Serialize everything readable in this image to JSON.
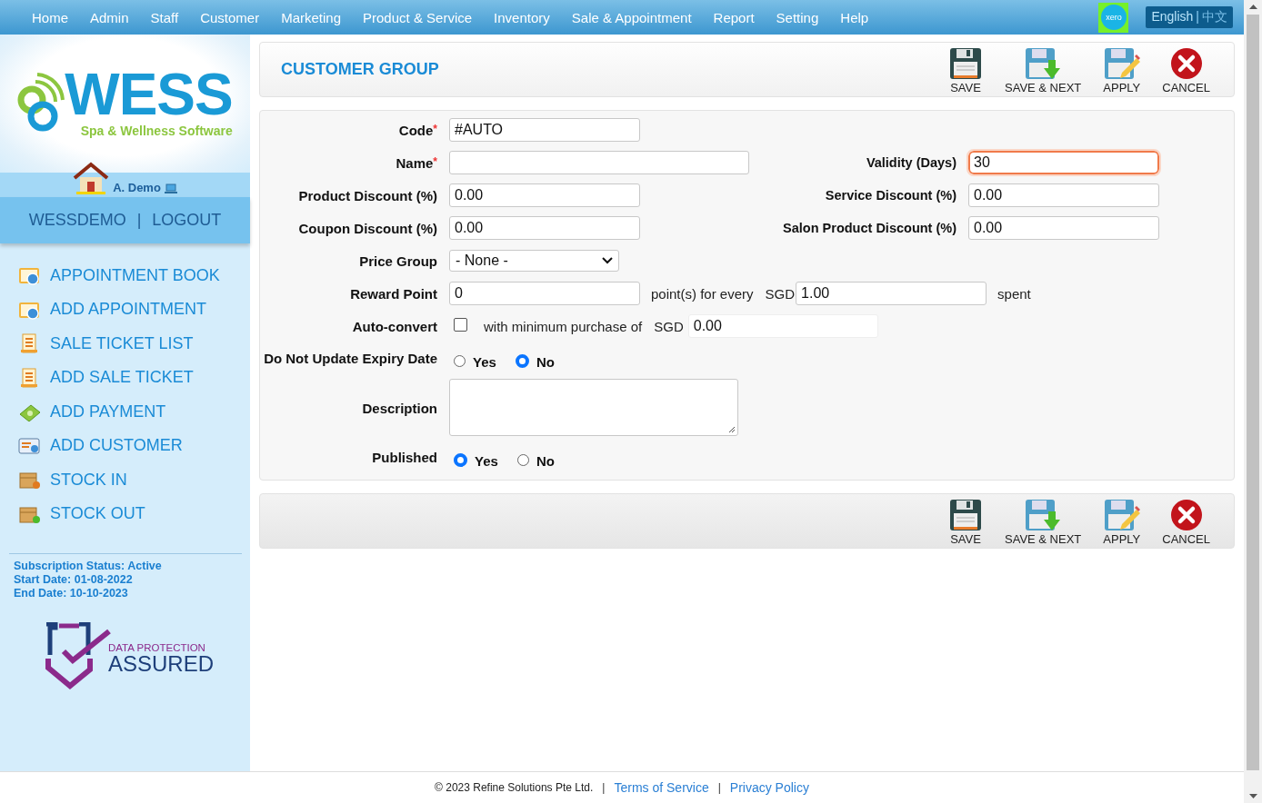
{
  "nav": {
    "items": [
      {
        "label": "Home"
      },
      {
        "label": "Admin"
      },
      {
        "label": "Staff"
      },
      {
        "label": "Customer"
      },
      {
        "label": "Marketing"
      },
      {
        "label": "Product & Service"
      },
      {
        "label": "Inventory"
      },
      {
        "label": "Sale & Appointment"
      },
      {
        "label": "Report"
      },
      {
        "label": "Setting"
      },
      {
        "label": "Help"
      }
    ],
    "xero": "xero",
    "language": {
      "separator": "|",
      "options": [
        {
          "label": "English",
          "selected": true
        },
        {
          "label": "中文",
          "selected": false
        }
      ]
    }
  },
  "sidebar": {
    "logo": {
      "name": "WESS",
      "tagline": "Spa & Wellness Software"
    },
    "user": "A. Demo",
    "account": {
      "links": [
        "WESSDEMO",
        "LOGOUT"
      ],
      "separator": "|"
    },
    "menu": [
      {
        "label": "APPOINTMENT BOOK"
      },
      {
        "label": "ADD APPOINTMENT"
      },
      {
        "label": "SALE TICKET LIST"
      },
      {
        "label": "ADD SALE TICKET"
      },
      {
        "label": "ADD PAYMENT"
      },
      {
        "label": "ADD CUSTOMER"
      },
      {
        "label": "STOCK IN"
      },
      {
        "label": "STOCK OUT"
      }
    ],
    "subscription": [
      "Subscription Status: Active",
      "Start Date: 01-08-2022",
      "End Date: 10-10-2023"
    ],
    "badge": {
      "line1": "DATA PROTECTION",
      "line2": "ASSURED"
    }
  },
  "page": {
    "title": "CUSTOMER GROUP",
    "toolbar_top": [
      {
        "label": "SAVE",
        "kind": "save"
      },
      {
        "label": "SAVE & NEXT",
        "kind": "save_next"
      },
      {
        "label": "APPLY",
        "kind": "apply"
      },
      {
        "label": "CANCEL",
        "kind": "cancel"
      }
    ],
    "form": [
      {
        "kind": "text",
        "label": "Code",
        "required_mark": "*",
        "value": "#AUTO"
      },
      {
        "kind": "wide_text",
        "label": "Name",
        "required_mark": "*",
        "right": {
          "label": "Validity (Days)",
          "value": "30",
          "focused": true
        }
      },
      {
        "kind": "text",
        "label": "Product Discount (%)",
        "value": "0.00",
        "right": {
          "label": "Service Discount (%)",
          "value": "0.00",
          "focused": false
        }
      },
      {
        "kind": "text",
        "label": "Coupon Discount (%)",
        "value": "0.00",
        "right": {
          "label": "Salon Product Discount (%)",
          "value": "0.00",
          "focused": false
        }
      },
      {
        "kind": "select",
        "label": "Price Group",
        "value": "- None -"
      },
      {
        "kind": "reward",
        "label": "Reward Point",
        "value": "0",
        "text": "point(s) for every",
        "currency": "SGD",
        "amount": "1.00",
        "suffix": "spent"
      },
      {
        "kind": "autoconvert",
        "label": "Auto-convert",
        "checked": false,
        "text": "with minimum purchase of",
        "currency": "SGD",
        "amount": "0.00"
      },
      {
        "kind": "radio",
        "label": "Do Not Update Expiry Date",
        "options": [
          {
            "label": "Yes",
            "selected": false
          },
          {
            "label": "No",
            "selected": true
          }
        ]
      },
      {
        "kind": "textarea",
        "label": "Description"
      },
      {
        "kind": "radio",
        "label": "Published",
        "options": [
          {
            "label": "Yes",
            "selected": true
          },
          {
            "label": "No",
            "selected": false
          }
        ]
      }
    ],
    "toolbar_bottom": [
      {
        "label": "SAVE",
        "kind": "save"
      },
      {
        "label": "SAVE & NEXT",
        "kind": "save_next"
      },
      {
        "label": "APPLY",
        "kind": "apply"
      },
      {
        "label": "CANCEL",
        "kind": "cancel"
      }
    ]
  },
  "footer": {
    "copyright": "© 2023 Refine Solutions Pte Ltd.",
    "separator": "|",
    "links": [
      "Terms of Service",
      "Privacy Policy"
    ]
  }
}
